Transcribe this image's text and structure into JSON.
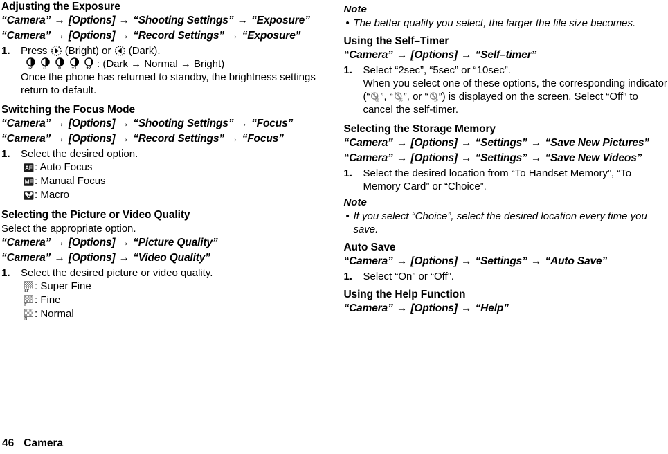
{
  "footer": {
    "page_number": "46",
    "chapter": "Camera"
  },
  "left_column": {
    "section1": {
      "heading": "Adjusting the Exposure",
      "path1": {
        "p1": "“Camera”",
        "p2": "[Options]",
        "p3": "“Shooting Settings”",
        "p4": "“Exposure”"
      },
      "path2": {
        "p1": "“Camera”",
        "p2": "[Options]",
        "p3": "“Record Settings”",
        "p4": "“Exposure”"
      },
      "step_num": "1.",
      "step_text_a": "Press",
      "step_text_b": "(Bright) or",
      "step_text_c": "(Dark).",
      "exposure_levels": [
        "-2",
        "-1",
        "0",
        "+1",
        "+2"
      ],
      "exposure_caption": ": (Dark → Normal → Bright)",
      "sub_text": "Once the phone has returned to standby, the brightness settings return to default."
    },
    "section2": {
      "heading": "Switching the Focus Mode",
      "path1": {
        "p1": "“Camera”",
        "p2": "[Options]",
        "p3": "“Shooting Settings”",
        "p4": "“Focus”"
      },
      "path2": {
        "p1": "“Camera”",
        "p2": "[Options]",
        "p3": "“Record Settings”",
        "p4": "“Focus”"
      },
      "step_num": "1.",
      "step_text": "Select the desired option.",
      "options": [
        {
          "icon": "af-badge-icon",
          "badge": "AF",
          "label": ": Auto Focus"
        },
        {
          "icon": "mf-badge-icon",
          "badge": "MF",
          "label": ": Manual Focus"
        },
        {
          "icon": "macro-flower-icon",
          "badge": "",
          "label": ": Macro"
        }
      ]
    },
    "section3": {
      "heading": "Selecting the Picture or Video Quality",
      "intro": "Select the appropriate option.",
      "path1": {
        "p1": "“Camera”",
        "p2": "[Options]",
        "p3": "“Picture Quality”"
      },
      "path2": {
        "p1": "“Camera”",
        "p2": "[Options]",
        "p3": "“Video Quality”"
      },
      "step_num": "1.",
      "step_text": "Select the desired picture or video quality.",
      "options": [
        {
          "icon": "quality-superfine-icon",
          "sub": "SF",
          "label": ": Super Fine"
        },
        {
          "icon": "quality-fine-icon",
          "sub": "F",
          "label": ": Fine"
        },
        {
          "icon": "quality-normal-icon",
          "sub": "N",
          "label": ": Normal"
        }
      ]
    }
  },
  "right_column": {
    "note1": {
      "heading": "Note",
      "bullet": "•",
      "text": "The better quality you select, the larger the file size becomes."
    },
    "section4": {
      "heading": "Using the Self–Timer",
      "path1": {
        "p1": "“Camera”",
        "p2": "[Options]",
        "p3": "“Self–timer”"
      },
      "step_num": "1.",
      "step_text": "Select “2sec”, “5sec” or “10sec”.",
      "sub_text_a": "When you select one of these options, the corresponding indicator (“",
      "sub_text_b": "”, “",
      "sub_text_c": "”, or “",
      "sub_text_d": "”) is displayed on the screen. Select “Off” to cancel the self-timer.",
      "timer_subs": [
        "02",
        "05",
        "10"
      ]
    },
    "section5": {
      "heading": "Selecting the Storage Memory",
      "path1": {
        "p1": "“Camera”",
        "p2": "[Options]",
        "p3": "“Settings”",
        "p4": "“Save New Pictures”"
      },
      "path2": {
        "p1": "“Camera”",
        "p2": "[Options]",
        "p3": "“Settings”",
        "p4": "“Save New Videos”"
      },
      "step_num": "1.",
      "step_text": "Select the desired location from “To Handset Memory”, “To Memory Card” or “Choice”."
    },
    "note2": {
      "heading": "Note",
      "bullet": "•",
      "text": "If you select “Choice”, select the desired location every time you save."
    },
    "section6": {
      "heading": "Auto Save",
      "path1": {
        "p1": "“Camera”",
        "p2": "[Options]",
        "p3": "“Settings”",
        "p4": "“Auto Save”"
      },
      "step_num": "1.",
      "step_text": "Select “On” or “Off”."
    },
    "section7": {
      "heading": "Using the Help Function",
      "path1": {
        "p1": "“Camera”",
        "p2": "[Options]",
        "p3": "“Help”"
      }
    }
  },
  "icons": {
    "arrow": "→"
  }
}
